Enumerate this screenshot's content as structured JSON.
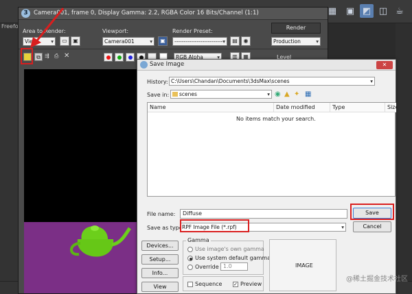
{
  "max_toolbar": {
    "viewport_label": "Freeform",
    "icons": [
      "render-setup-icon",
      "render-frame-icon",
      "render-icon",
      "material-editor-icon",
      "teapot-icon"
    ]
  },
  "render_frame": {
    "title": "Camera001, frame 0, Display Gamma: 2.2, RGBA Color 16 Bits/Channel (1:1)",
    "area_label": "Area to Render:",
    "area_value": "View",
    "viewport_label": "Viewport:",
    "viewport_value": "Camera001",
    "preset_label": "Render Preset:",
    "preset_value": "--------------------------",
    "render_button": "Render",
    "mode_value": "Production",
    "channel_value": "RGB Alpha",
    "level_label": "Level"
  },
  "dialog": {
    "title": "Save Image",
    "history_label": "History:",
    "history_value": "C:\\Users\\Chandan\\Documents\\3dsMax\\scenes",
    "savein_label": "Save in:",
    "savein_value": "scenes",
    "columns": [
      "Name",
      "Date modified",
      "Type",
      "Size"
    ],
    "empty_message": "No items match your search.",
    "filename_label": "File name:",
    "filename_value": "Diffuse",
    "savetype_label": "Save as type:",
    "savetype_value": "RPF Image File (*.rpf)",
    "save_button": "Save",
    "cancel_button": "Cancel",
    "devices_button": "Devices...",
    "setup_button": "Setup...",
    "info_button": "Info...",
    "view_button": "View",
    "gamma_label": "Gamma",
    "gamma_options": [
      "Use image's own gamma",
      "Use system default gamma",
      "Override"
    ],
    "override_value": "1.0",
    "image_label": "IMAGE",
    "sequence_label": "Sequence",
    "preview_label": "Preview"
  },
  "watermark": "@稀土掘金技术社区"
}
